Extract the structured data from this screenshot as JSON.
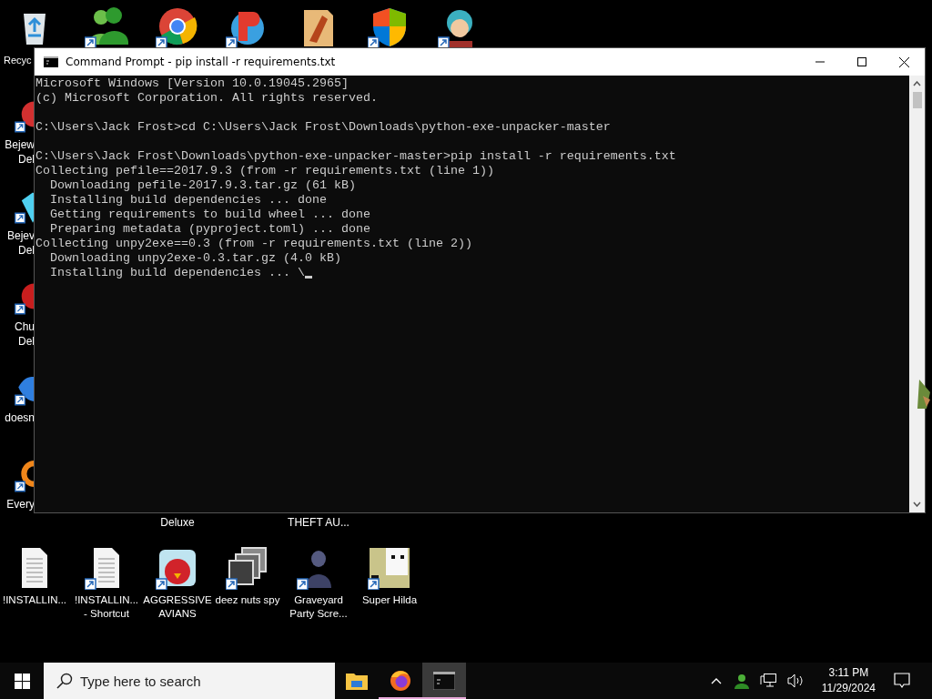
{
  "desktop": {
    "top_row": [
      {
        "kind": "recycle",
        "shortcut": false,
        "label": "Recyc"
      },
      {
        "kind": "people",
        "shortcut": true
      },
      {
        "kind": "browser",
        "shortcut": true
      },
      {
        "kind": "game",
        "shortcut": true
      },
      {
        "kind": "folder",
        "shortcut": false
      },
      {
        "kind": "shield",
        "shortcut": true
      },
      {
        "kind": "character",
        "shortcut": true
      }
    ],
    "left_column": [
      {
        "kind": "game",
        "shortcut": true,
        "lines": [
          "Bejew",
          "Del"
        ]
      },
      {
        "kind": "gem",
        "shortcut": true,
        "lines": [
          "Bejev",
          "Del"
        ]
      },
      {
        "kind": "blob",
        "shortcut": true,
        "lines": [
          "Chu",
          "Del"
        ]
      },
      {
        "kind": "bird",
        "shortcut": true,
        "lines": [
          "doesn"
        ]
      },
      {
        "kind": "ring",
        "shortcut": true,
        "lines": [
          "Every"
        ]
      }
    ],
    "hidden_labels": [
      "Deluxe",
      "THEFT AU..."
    ],
    "bottom_row": [
      {
        "kind": "document",
        "shortcut": false,
        "lines": [
          "!INSTALLIN..."
        ]
      },
      {
        "kind": "document",
        "shortcut": true,
        "lines": [
          "!INSTALLIN...",
          "- Shortcut"
        ]
      },
      {
        "kind": "angry",
        "shortcut": true,
        "lines": [
          "AGGRESSIVE",
          "AVIANS"
        ]
      },
      {
        "kind": "stack",
        "shortcut": true,
        "lines": [
          "deez nuts spy"
        ]
      },
      {
        "kind": "statue",
        "shortcut": true,
        "lines": [
          "Graveyard",
          "Party Scre..."
        ]
      },
      {
        "kind": "pixel",
        "shortcut": true,
        "lines": [
          "Super Hilda"
        ]
      }
    ]
  },
  "window": {
    "title": "Command Prompt - pip  install -r requirements.txt",
    "blocks": [
      [
        "Microsoft Windows [Version 10.0.19045.2965]",
        "(c) Microsoft Corporation. All rights reserved."
      ],
      [
        "C:\\Users\\Jack Frost>cd C:\\Users\\Jack Frost\\Downloads\\python-exe-unpacker-master"
      ],
      [
        "C:\\Users\\Jack Frost\\Downloads\\python-exe-unpacker-master>pip install -r requirements.txt",
        "Collecting pefile==2017.9.3 (from -r requirements.txt (line 1))",
        "  Downloading pefile-2017.9.3.tar.gz (61 kB)",
        "  Installing build dependencies ... done",
        "  Getting requirements to build wheel ... done",
        "  Preparing metadata (pyproject.toml) ... done",
        "Collecting unpy2exe==0.3 (from -r requirements.txt (line 2))",
        "  Downloading unpy2exe-0.3.tar.gz (4.0 kB)",
        "  Installing build dependencies ... \\"
      ]
    ],
    "cursor": true
  },
  "taskbar": {
    "search": {
      "placeholder": "Type here to search"
    },
    "apps": [
      {
        "kind": "explorer",
        "running": false,
        "selected": false
      },
      {
        "kind": "firefox",
        "running": true,
        "selected": false
      },
      {
        "kind": "terminal",
        "running": true,
        "selected": true
      }
    ],
    "time": "3:11 PM",
    "date": "11/29/2024"
  }
}
